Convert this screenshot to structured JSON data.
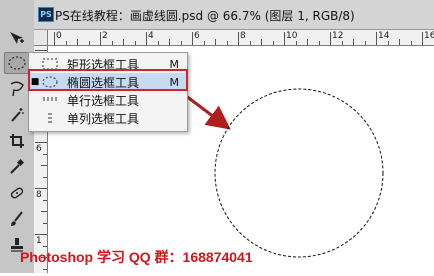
{
  "window": {
    "badge": "PS",
    "title": "PS在线教程：画虚线圆.psd @ 66.7% (图层 1, RGB/8)"
  },
  "rulers": {
    "top_labels": [
      "0",
      "2",
      "4",
      "6",
      "8",
      "10",
      "12",
      "14",
      "16"
    ],
    "left_labels": [
      "0",
      "4",
      "6",
      "8",
      "1"
    ]
  },
  "tool_menu": {
    "items": [
      {
        "label": "矩形选框工具",
        "shortcut": "M",
        "icon": "rect-marquee-icon",
        "selected": false
      },
      {
        "label": "椭圆选框工具",
        "shortcut": "M",
        "icon": "ellipse-marquee-icon",
        "selected": true
      },
      {
        "label": "单行选框工具",
        "shortcut": "",
        "icon": "single-row-marquee-icon",
        "selected": false
      },
      {
        "label": "单列选框工具",
        "shortcut": "",
        "icon": "single-column-marquee-icon",
        "selected": false
      }
    ]
  },
  "annotation": {
    "highlight_color": "#d0262a",
    "arrow_color": "#b01e1e"
  },
  "watermark": {
    "text": "Photoshop 学习 QQ 群：168874041",
    "color": "#d4151c"
  },
  "toolbar": {
    "tools": [
      "move-tool-icon",
      "ellipse-marquee-tool-icon",
      "lasso-tool-icon",
      "magic-wand-tool-icon",
      "crop-tool-icon",
      "eyedropper-tool-icon",
      "healing-brush-tool-icon",
      "brush-tool-icon",
      "stamp-tool-icon"
    ]
  }
}
